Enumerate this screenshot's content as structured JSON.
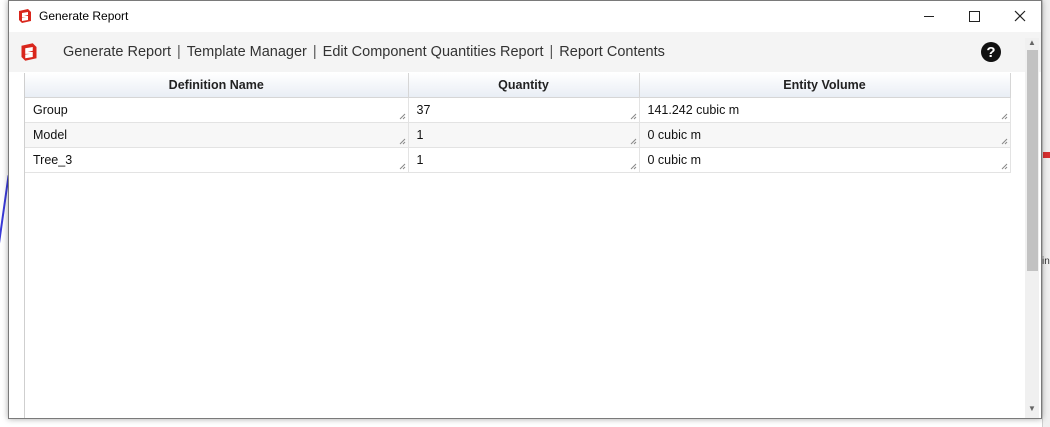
{
  "window": {
    "title": "Generate Report",
    "app_icon": "sketchup-icon",
    "controls": {
      "minimize_icon": "minimize-icon",
      "maximize_icon": "maximize-icon",
      "close_icon": "close-icon"
    }
  },
  "toolbar": {
    "icon": "sketchup-icon",
    "links": [
      {
        "label": "Generate Report"
      },
      {
        "label": "Template Manager"
      },
      {
        "label": "Edit Component Quantities Report"
      },
      {
        "label": "Report Contents"
      }
    ],
    "separator": "|",
    "help_glyph": "?"
  },
  "table": {
    "columns": [
      "Definition Name",
      "Quantity",
      "Entity Volume"
    ],
    "rows": [
      {
        "name": "Group",
        "quantity": "37",
        "volume": "141.242 cubic m"
      },
      {
        "name": "Model",
        "quantity": "1",
        "volume": "0 cubic m"
      },
      {
        "name": "Tree_3",
        "quantity": "1",
        "volume": "0 cubic m"
      }
    ]
  },
  "background": {
    "partial_text": "in"
  },
  "colors": {
    "accent": "#d83030",
    "header_bg": "#e9eef5"
  }
}
